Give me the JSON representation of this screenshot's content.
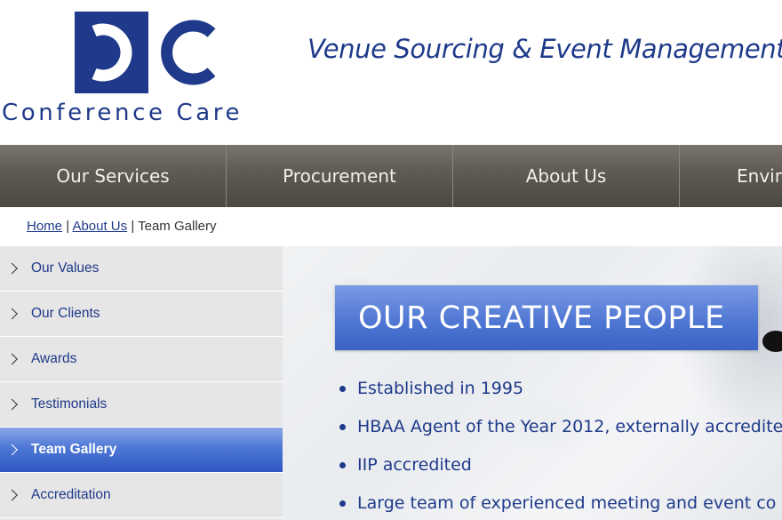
{
  "brand": {
    "name": "Conference Care",
    "tagline": "Venue Sourcing & Event Management",
    "color": "#1f3a8a"
  },
  "nav": {
    "items": [
      {
        "label": "Our Services"
      },
      {
        "label": "Procurement"
      },
      {
        "label": "About Us"
      },
      {
        "label": "Envir"
      }
    ]
  },
  "breadcrumb": {
    "home": "Home",
    "about": "About Us",
    "current": "Team Gallery",
    "separator": "|"
  },
  "sidebar": {
    "items": [
      {
        "label": "Our Values"
      },
      {
        "label": "Our Clients"
      },
      {
        "label": "Awards"
      },
      {
        "label": "Testimonials"
      },
      {
        "label": "Team Gallery"
      },
      {
        "label": "Accreditation"
      }
    ],
    "active_index": 4,
    "active_color": "#3e68cc"
  },
  "main": {
    "headline": "OUR CREATIVE PEOPLE",
    "bullets": [
      "Established in 1995",
      "HBAA Agent of the Year 2012, externally accredite",
      "IIP accredited",
      "Large team of experienced meeting and event co"
    ]
  },
  "icons": {
    "list_chevron": "chevron-right-icon",
    "bullet": "bullet-dot-icon"
  }
}
